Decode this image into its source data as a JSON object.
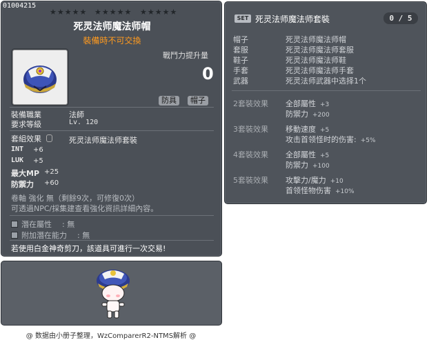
{
  "item": {
    "id": "01004215",
    "stars": [
      "★★★★★",
      "★★★★★",
      "★★★★★"
    ],
    "name": "死灵法师魔法师帽",
    "trade_note": "裝備時不可交換",
    "power_label": "戰鬥力提升量",
    "power_value": "0",
    "tags": [
      "防具",
      "帽子"
    ],
    "job_label": "裝備職業",
    "job_value": "法師",
    "level_label": "要求等級",
    "level_value": "Lv. 120",
    "set_label": "套組效果",
    "set_value": "死灵法师魔法师套裝",
    "stats": [
      {
        "name": "INT",
        "value": "+6"
      },
      {
        "name": "LUK",
        "value": "+5"
      },
      {
        "name": "最大MP",
        "value": "+25"
      },
      {
        "name": "防禦力",
        "value": "+60"
      }
    ],
    "scroll_line": "卷軸 強化 無（剩餘9次，可修復0次）",
    "enhance_line": "可透過NPC/採集建查看強化資訊詳細內容。",
    "potential_label": "潛在屬性",
    "potential_value": "無",
    "add_potential_label": "附加潛在能力",
    "add_potential_value": "無",
    "trade_line": "若使用白金神奇剪刀，該道具可進行一次交易!"
  },
  "set": {
    "badge": "SET",
    "title": "死灵法师魔法师套裝",
    "count": "0 / 5",
    "pieces": [
      {
        "slot": "帽子",
        "name": "死灵法师魔法师帽"
      },
      {
        "slot": "套服",
        "name": "死灵法师魔法师套服"
      },
      {
        "slot": "鞋子",
        "name": "死灵法师魔法师鞋"
      },
      {
        "slot": "手套",
        "name": "死灵法师魔法师手套"
      },
      {
        "slot": "武器",
        "name": "死灵法师武器中选择1个"
      }
    ],
    "effects": [
      {
        "label": "2套裝效果",
        "lines": [
          {
            "t": "全部屬性",
            "v": "+3"
          },
          {
            "t": "防禦力",
            "v": "+200"
          }
        ]
      },
      {
        "label": "3套裝效果",
        "lines": [
          {
            "t": "移動速度",
            "v": "+5"
          },
          {
            "t": "攻击首领怪时的伤害:",
            "v": "+5%"
          }
        ]
      },
      {
        "label": "4套裝效果",
        "lines": [
          {
            "t": "全部屬性",
            "v": "+5"
          },
          {
            "t": "防禦力",
            "v": "+100"
          }
        ]
      },
      {
        "label": "5套裝效果",
        "lines": [
          {
            "t": "攻擊力/魔力",
            "v": "+10"
          },
          {
            "t": "首领怪物伤害",
            "v": "+10%"
          }
        ]
      }
    ]
  },
  "footer": "@ 数据由小册子整理，WzComparerR2-NTMS解析 @",
  "colors": {
    "panel": "#4b5057",
    "accent_orange": "#ff9a1f"
  }
}
